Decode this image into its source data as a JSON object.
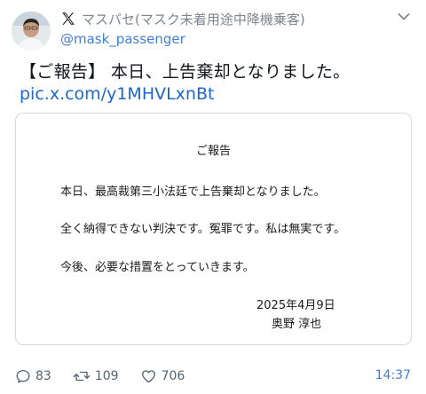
{
  "author": {
    "display_name": "マスパセ(マスク未着用途中降機乗客)",
    "handle": "@mask_passenger"
  },
  "tweet": {
    "text": "【ご報告】 本日、上告棄却となりました。",
    "link": "pic.x.com/y1MHVLxnBt"
  },
  "card": {
    "title": "ご報告",
    "line1": "本日、最高裁第三小法廷で上告棄却となりました。",
    "line2": "全く納得できない判決です。冤罪です。私は無実です。",
    "line3": "今後、必要な措置をとっていきます。",
    "date": "2025年4月9日",
    "author": "奥野 淳也"
  },
  "stats": {
    "replies": "83",
    "reposts": "109",
    "likes": "706"
  },
  "timestamp": "14:37",
  "colors": {
    "link": "#1d67c8",
    "handle": "#3f7fd6",
    "muted": "#536471"
  },
  "icons": [
    "avatar",
    "x-logo-icon",
    "chevron-down-icon",
    "reply-icon",
    "repost-icon",
    "like-icon"
  ]
}
